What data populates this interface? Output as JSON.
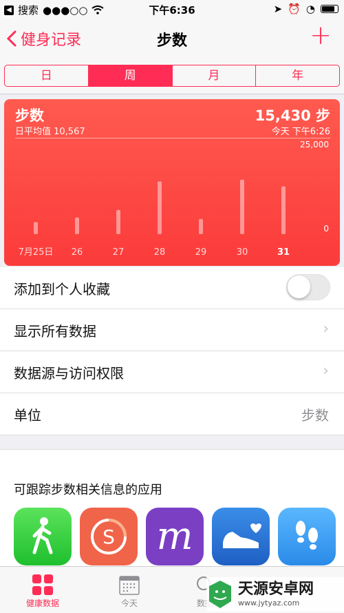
{
  "status_bar": {
    "back_app": "搜索",
    "time": "下午6:36"
  },
  "nav": {
    "back_label": "健身记录",
    "title": "步数",
    "add_label": "+"
  },
  "segments": [
    {
      "label": "日",
      "active": false
    },
    {
      "label": "周",
      "active": true
    },
    {
      "label": "月",
      "active": false
    },
    {
      "label": "年",
      "active": false
    }
  ],
  "summary": {
    "title": "步数",
    "average_label": "日平均值 10,567",
    "total": "15,430 步",
    "timestamp": "今天 下午6:26"
  },
  "chart_data": {
    "type": "bar",
    "categories": [
      "7月25日",
      "26",
      "27",
      "28",
      "29",
      "30",
      "31"
    ],
    "values": [
      3500,
      4800,
      7000,
      15200,
      4400,
      15700,
      13800
    ],
    "ylim": [
      0,
      25000
    ],
    "y_ticks": [
      "25,000",
      "0"
    ],
    "highlight_index": 6
  },
  "list": {
    "add_favorite": "添加到个人收藏",
    "favorite_on": false,
    "show_all": "显示所有数据",
    "sources": "数据源与访问权限",
    "unit_label": "单位",
    "unit_value": "步数"
  },
  "apps": {
    "heading": "可跟踪步数相关信息的应用"
  },
  "tabs": [
    {
      "label": "健康数据",
      "active": true
    },
    {
      "label": "今天",
      "active": false
    },
    {
      "label": "数据",
      "active": false
    }
  ],
  "watermark": {
    "brand": "天源安卓网",
    "url": "www.jytyaz.com"
  }
}
